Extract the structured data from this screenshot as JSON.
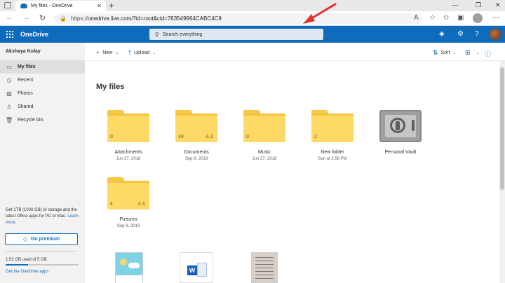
{
  "browser": {
    "tab_title": "My files - OneDrive",
    "tab_close": "✕",
    "new_tab": "+",
    "url_scheme": "https://",
    "url_rest": "onedrive.live.com/?id=root&cid=763549964CABC4C9"
  },
  "header": {
    "brand": "OneDrive",
    "search_placeholder": "Search everything"
  },
  "sidebar": {
    "user_name": "Akshaya Kolay",
    "items": [
      {
        "label": "My files",
        "icon": "folder-icon"
      },
      {
        "label": "Recent",
        "icon": "clock-icon"
      },
      {
        "label": "Photos",
        "icon": "image-icon"
      },
      {
        "label": "Shared",
        "icon": "people-icon"
      },
      {
        "label": "Recycle bin",
        "icon": "recycle-bin-icon"
      }
    ],
    "promo_text": "Get 1TB (1000 GB) of storage and the latest Office apps for PC or Mac.",
    "learn_more": "Learn more.",
    "premium_label": "Go premium",
    "storage_text": "1.52 GB used of 5 GB",
    "storage_fraction": 0.304,
    "get_apps": "Get the OneDrive apps"
  },
  "commands": {
    "new_label": "New",
    "upload_label": "Upload",
    "sort_label": "Sort"
  },
  "main": {
    "title": "My files",
    "folders": [
      {
        "name": "Attachments",
        "date": "Jun 27, 2018",
        "count": "0",
        "shared": false
      },
      {
        "name": "Documents",
        "date": "Sep 9, 2019",
        "count": "49",
        "shared": true
      },
      {
        "name": "Music",
        "date": "Jun 27, 2018",
        "count": "0",
        "shared": false
      },
      {
        "name": "New folder",
        "date": "Sun at 2:56 PM",
        "count": "2",
        "shared": false
      },
      {
        "name": "Personal Vault",
        "date": "",
        "count": "",
        "shared": false
      },
      {
        "name": "Pictures",
        "date": "Sep 9, 2019",
        "count": "4",
        "shared": true
      }
    ]
  },
  "colors": {
    "accent": "#0f6cbd",
    "folder": "#ffd965",
    "arrow": "#e0342b"
  }
}
